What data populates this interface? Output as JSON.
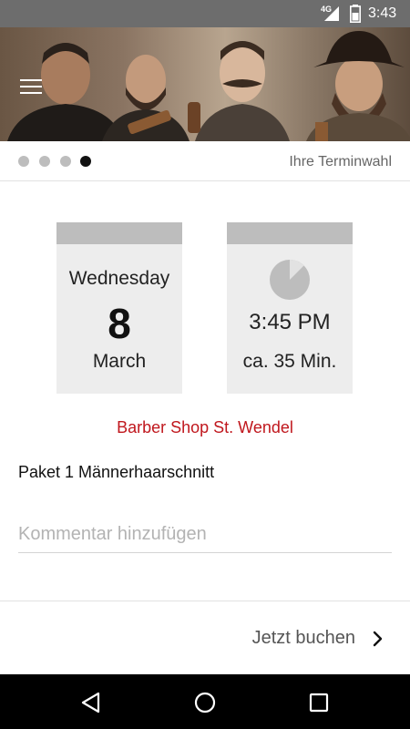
{
  "status_bar": {
    "network": "4G",
    "time": "3:43",
    "icons": [
      "signal-icon",
      "battery-icon"
    ]
  },
  "header": {
    "menu_icon": "hamburger-menu-icon"
  },
  "steps": {
    "total": 4,
    "active_index": 3,
    "title": "Ihre Terminwahl"
  },
  "date_card": {
    "weekday": "Wednesday",
    "day": "8",
    "month": "March"
  },
  "time_card": {
    "icon": "clock-icon",
    "time": "3:45 PM",
    "duration": "ca. 35 Min."
  },
  "shop_name": "Barber Shop St. Wendel",
  "package": "Paket 1 Männerhaarschnitt",
  "comment": {
    "value": "",
    "placeholder": "Kommentar hinzufügen"
  },
  "book": {
    "label": "Jetzt buchen",
    "icon": "chevron-right-icon"
  },
  "navbar": {
    "icons": [
      "back-icon",
      "home-icon",
      "recent-apps-icon"
    ]
  },
  "colors": {
    "status_bar": "#6d6d6d",
    "accent_red": "#c0171d",
    "card_bg": "#ededed",
    "card_header": "#bdbdbd",
    "active_dot": "#111111",
    "inactive_dot": "#bdbdbd"
  }
}
